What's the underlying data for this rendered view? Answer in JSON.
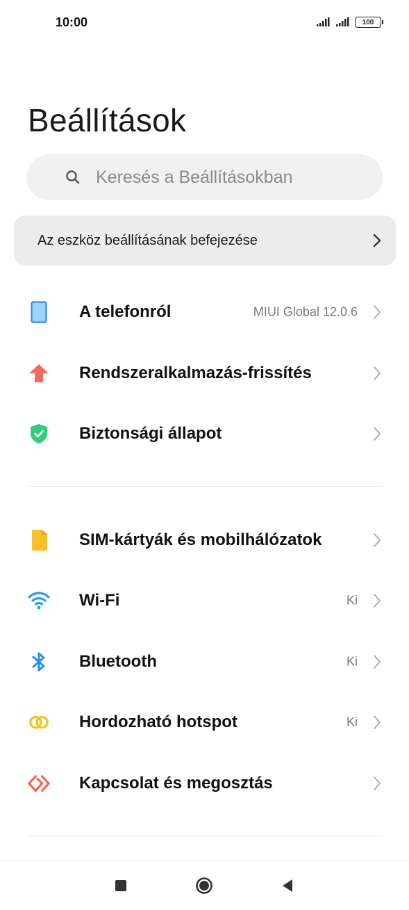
{
  "status_bar": {
    "time": "10:00",
    "battery": "100"
  },
  "page": {
    "title": "Beállítások"
  },
  "search": {
    "placeholder": "Keresés a Beállításokban"
  },
  "setup_banner": {
    "label": "Az eszköz beállításának befejezése"
  },
  "rows": [
    {
      "id": "about-phone",
      "label": "A telefonról",
      "value": "MIUI Global 12.0.6",
      "icon": "phone-icon",
      "color": "#4aa3f0"
    },
    {
      "id": "system-update",
      "label": "Rendszeralkalmazás-frissítés",
      "value": "",
      "icon": "arrow-up-icon",
      "color": "#f26b5b"
    },
    {
      "id": "security-status",
      "label": "Biztonsági állapot",
      "value": "",
      "icon": "shield-icon",
      "color": "#2fce7a"
    },
    {
      "id": "sim-cards",
      "label": "SIM-kártyák és mobilhálózatok",
      "value": "",
      "icon": "sim-card-icon",
      "color": "#f8c02a"
    },
    {
      "id": "wifi",
      "label": "Wi-Fi",
      "value": "Ki",
      "icon": "wifi-icon",
      "color": "#2a9bf0"
    },
    {
      "id": "bluetooth",
      "label": "Bluetooth",
      "value": "Ki",
      "icon": "bluetooth-icon",
      "color": "#2a8ff0"
    },
    {
      "id": "hotspot",
      "label": "Hordozható hotspot",
      "value": "Ki",
      "icon": "hotspot-icon",
      "color": "#f5c41c"
    },
    {
      "id": "connection-sharing",
      "label": "Kapcsolat és megosztás",
      "value": "",
      "icon": "share-icon",
      "color": "#f06a55"
    }
  ]
}
